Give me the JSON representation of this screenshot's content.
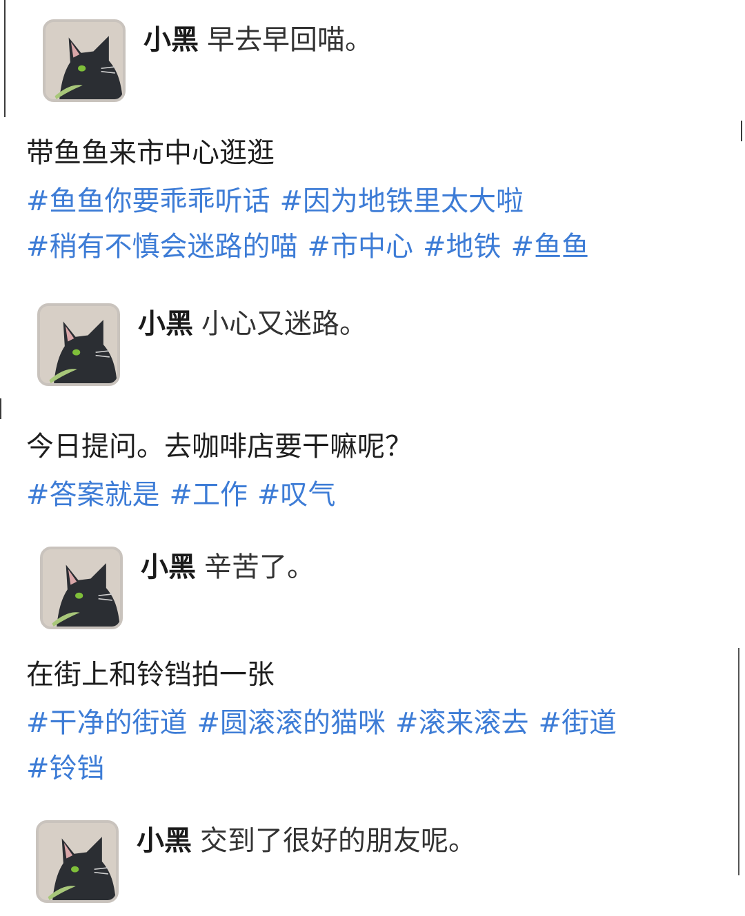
{
  "comments": [
    {
      "author": "小黑",
      "text": "早去早回喵。"
    },
    {
      "author": "小黑",
      "text": "小心又迷路。"
    },
    {
      "author": "小黑",
      "text": "辛苦了。"
    },
    {
      "author": "小黑",
      "text": "交到了很好的朋友呢。"
    }
  ],
  "posts": [
    {
      "text": "带鱼鱼来市中心逛逛",
      "tags": [
        "#鱼鱼你要乖乖听话",
        "#因为地铁里太大啦",
        "#稍有不慎会迷路的喵",
        "#市中心",
        "#地铁",
        "#鱼鱼"
      ]
    },
    {
      "text": "今日提问。去咖啡店要干嘛呢？",
      "tags": [
        "#答案就是",
        "#工作",
        "#叹气"
      ]
    },
    {
      "text": "在街上和铃铛拍一张",
      "tags": [
        "#干净的街道",
        "#圆滚滚的猫咪",
        "#滚来滚去",
        "#街道",
        "#铃铛"
      ]
    }
  ],
  "colors": {
    "hashtag": "#3d7cd6",
    "avatar_bg": "#d7cfc6",
    "cat": "#2b2e33",
    "eye": "#7fbf3a"
  },
  "icons": {
    "avatar": "black-cat-avatar-icon"
  }
}
